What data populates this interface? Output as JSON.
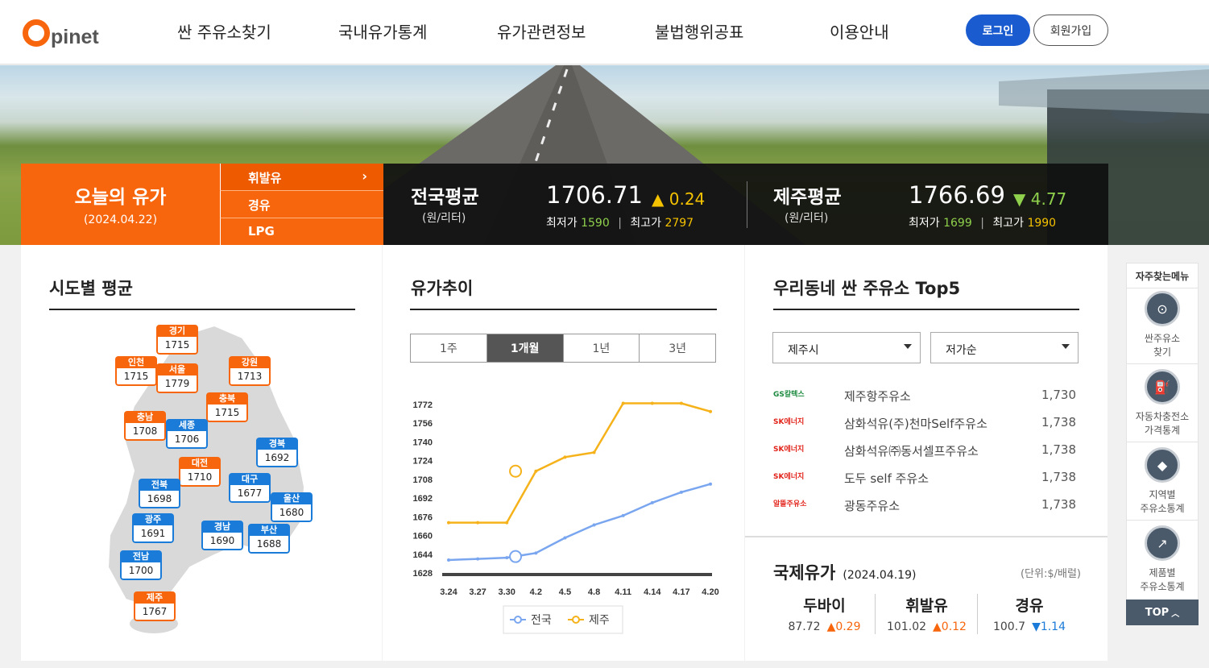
{
  "header": {
    "logo_text": "pinet",
    "nav": [
      "싼 주유소찾기",
      "국내유가통계",
      "유가관련정보",
      "불법행위공표",
      "이용안내"
    ],
    "login_label": "로그인",
    "join_label": "회원가입"
  },
  "today": {
    "title": "오늘의 유가",
    "date": "(2024.04.22)",
    "fuels": [
      "휘발유",
      "경유",
      "LPG"
    ],
    "chev": "›"
  },
  "national": {
    "title": "전국평균",
    "unit": "(원/리터)",
    "value": "1706.71",
    "change_arrow": "▲",
    "change": "0.24",
    "min_label": "최저가",
    "min": "1590",
    "sep": "|",
    "max_label": "최고가",
    "max": "2797"
  },
  "jeju": {
    "title": "제주평균",
    "unit": "(원/리터)",
    "value": "1766.69",
    "change_arrow": "▼",
    "change": "4.77",
    "min_label": "최저가",
    "min": "1699",
    "sep": "|",
    "max_label": "최고가",
    "max": "1990"
  },
  "regional": {
    "title": "시도별 평균",
    "regions": [
      {
        "name": "경기",
        "value": "1715",
        "color": "orange"
      },
      {
        "name": "인천",
        "value": "1715",
        "color": "orange"
      },
      {
        "name": "서울",
        "value": "1779",
        "color": "orange"
      },
      {
        "name": "강원",
        "value": "1713",
        "color": "orange"
      },
      {
        "name": "충북",
        "value": "1715",
        "color": "orange"
      },
      {
        "name": "충남",
        "value": "1708",
        "color": "orange"
      },
      {
        "name": "세종",
        "value": "1706",
        "color": "blue"
      },
      {
        "name": "경북",
        "value": "1692",
        "color": "blue"
      },
      {
        "name": "대전",
        "value": "1710",
        "color": "orange"
      },
      {
        "name": "전북",
        "value": "1698",
        "color": "blue"
      },
      {
        "name": "대구",
        "value": "1677",
        "color": "blue"
      },
      {
        "name": "울산",
        "value": "1680",
        "color": "blue"
      },
      {
        "name": "광주",
        "value": "1691",
        "color": "blue"
      },
      {
        "name": "경남",
        "value": "1690",
        "color": "blue"
      },
      {
        "name": "부산",
        "value": "1688",
        "color": "blue"
      },
      {
        "name": "전남",
        "value": "1700",
        "color": "blue"
      },
      {
        "name": "제주",
        "value": "1767",
        "color": "orange"
      }
    ]
  },
  "trend": {
    "title": "유가추이",
    "tabs": [
      "1주",
      "1개월",
      "1년",
      "3년"
    ],
    "active_tab": 1
  },
  "chart_data": {
    "type": "line",
    "x": [
      "3.24",
      "3.27",
      "3.30",
      "4.2",
      "4.5",
      "4.8",
      "4.11",
      "4.14",
      "4.17",
      "4.20"
    ],
    "yticks": [
      1628,
      1644,
      1660,
      1676,
      1692,
      1708,
      1724,
      1740,
      1756,
      1772
    ],
    "ylim": [
      1628,
      1772
    ],
    "series": [
      {
        "name": "전국",
        "color": "#7aa6f0",
        "values": [
          1639,
          1640,
          1641,
          1645,
          1658,
          1669,
          1677,
          1688,
          1697,
          1704
        ]
      },
      {
        "name": "제주",
        "color": "#f5b21a",
        "values": [
          1671,
          1671,
          1671,
          1715,
          1727,
          1731,
          1773,
          1773,
          1773,
          1766
        ]
      }
    ],
    "legend": "bottom"
  },
  "top5": {
    "title": "우리동네 싼 주유소 Top5",
    "city": "제주시",
    "sort": "저가순",
    "stations": [
      {
        "brand": "GS칼텍스",
        "brand_color": "#1b8a3f",
        "name": "제주항주유소",
        "price": "1,730"
      },
      {
        "brand": "SK에너지",
        "brand_color": "#e2231a",
        "name": "삼화석유(주)천마Self주유소",
        "price": "1,738"
      },
      {
        "brand": "SK에너지",
        "brand_color": "#e2231a",
        "name": "삼화석유㈜동서셀프주유소",
        "price": "1,738"
      },
      {
        "brand": "SK에너지",
        "brand_color": "#e2231a",
        "name": "도두 self 주유소",
        "price": "1,738"
      },
      {
        "brand": "알뜰주유소",
        "brand_color": "#e2231a",
        "name": "광동주유소",
        "price": "1,738"
      }
    ]
  },
  "intl": {
    "title": "국제유가",
    "date": "(2024.04.19)",
    "unit": "(단위:$/배럴)",
    "items": [
      {
        "name": "두바이",
        "value": "87.72",
        "arrow": "▲",
        "change": "0.29",
        "dir": "up"
      },
      {
        "name": "휘발유",
        "value": "101.02",
        "arrow": "▲",
        "change": "0.12",
        "dir": "up"
      },
      {
        "name": "경유",
        "value": "100.7",
        "arrow": "▼",
        "change": "1.14",
        "dir": "down"
      }
    ]
  },
  "quick": {
    "title": "자주찾는메뉴",
    "items": [
      {
        "label1": "싼주유소",
        "label2": "찾기",
        "icon": "gas-pin-icon"
      },
      {
        "label1": "자동차충전소",
        "label2": "가격통계",
        "icon": "fuel-pump-icon"
      },
      {
        "label1": "지역별",
        "label2": "주유소통계",
        "icon": "korea-map-icon"
      },
      {
        "label1": "제품별",
        "label2": "주유소통계",
        "icon": "line-chart-icon"
      }
    ],
    "top_label": "TOP"
  },
  "colors": {
    "brand_orange": "#f7660d",
    "login_blue": "#1b5bd0",
    "up_orange": "#f7660d",
    "down_blue": "#1a7bd8"
  }
}
